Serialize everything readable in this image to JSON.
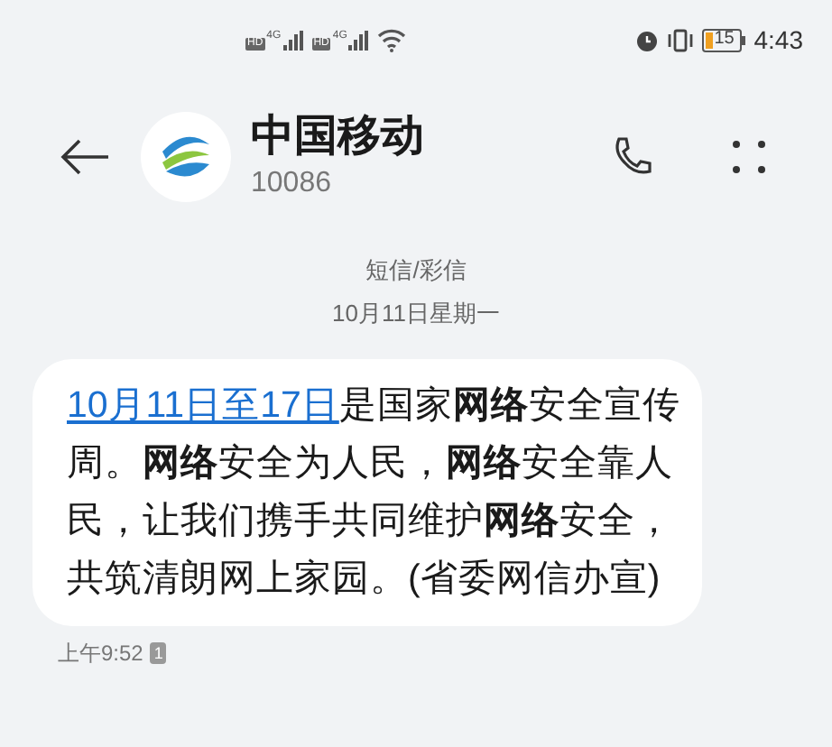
{
  "status_bar": {
    "sims": [
      {
        "badge": "HD",
        "network": "4G"
      },
      {
        "badge": "HD",
        "network": "4G"
      }
    ],
    "battery": "15",
    "time": "4:43"
  },
  "header": {
    "name": "中国移动",
    "number": "10086"
  },
  "thread": {
    "type": "短信/彩信",
    "date": "10月11日星期一"
  },
  "message": {
    "link": "10月11日至17日",
    "body": "是国家**网络**安全宣传周。**网络**安全为人民，**网络**安全靠人民，让我们携手共同维护**网络**安全，共筑清朗网上家园。(省委网信办宣)",
    "time": "上午9:52",
    "sim": "1"
  }
}
